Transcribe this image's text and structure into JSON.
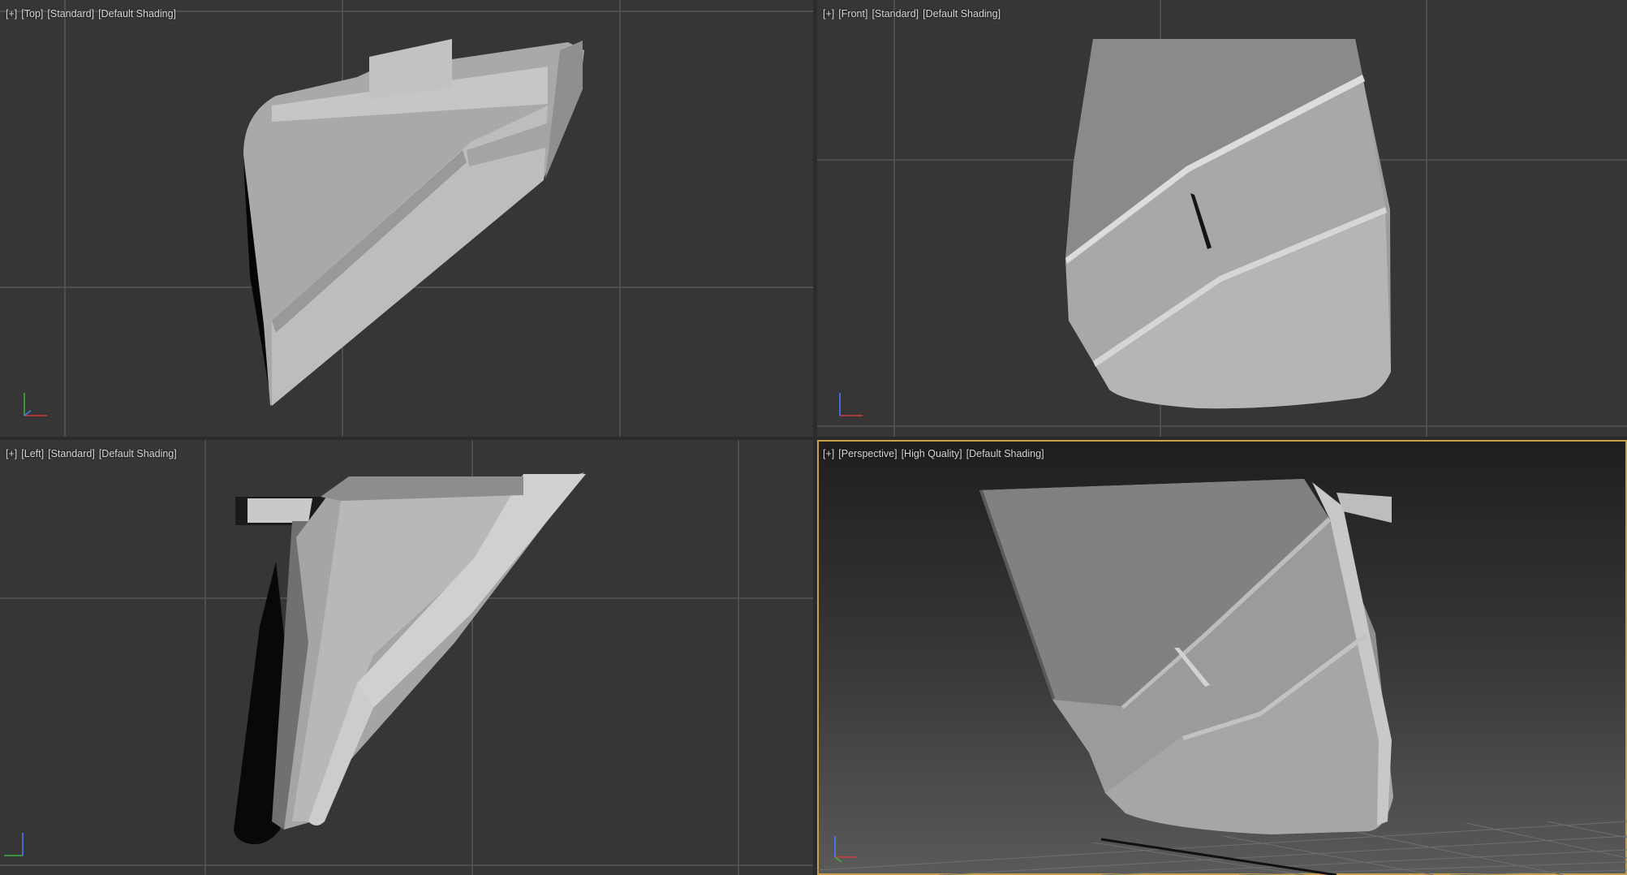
{
  "viewports": {
    "top": {
      "menu": "+",
      "view": "Top",
      "mode": "Standard",
      "shading": "Default Shading"
    },
    "front": {
      "menu": "+",
      "view": "Front",
      "mode": "Standard",
      "shading": "Default Shading"
    },
    "left": {
      "menu": "+",
      "view": "Left",
      "mode": "Standard",
      "shading": "Default Shading"
    },
    "perspective": {
      "menu": "+",
      "view": "Perspective",
      "mode": "High Quality",
      "shading": "Default Shading",
      "active": true
    }
  },
  "colors": {
    "viewport_bg": "#363636",
    "grid_line": "#565656",
    "active_border": "#c9a04a",
    "axis_x": "#d23a3a",
    "axis_y": "#3cb43c",
    "axis_z": "#4a7cff"
  },
  "icons": [
    "axis-tripod-icon"
  ]
}
